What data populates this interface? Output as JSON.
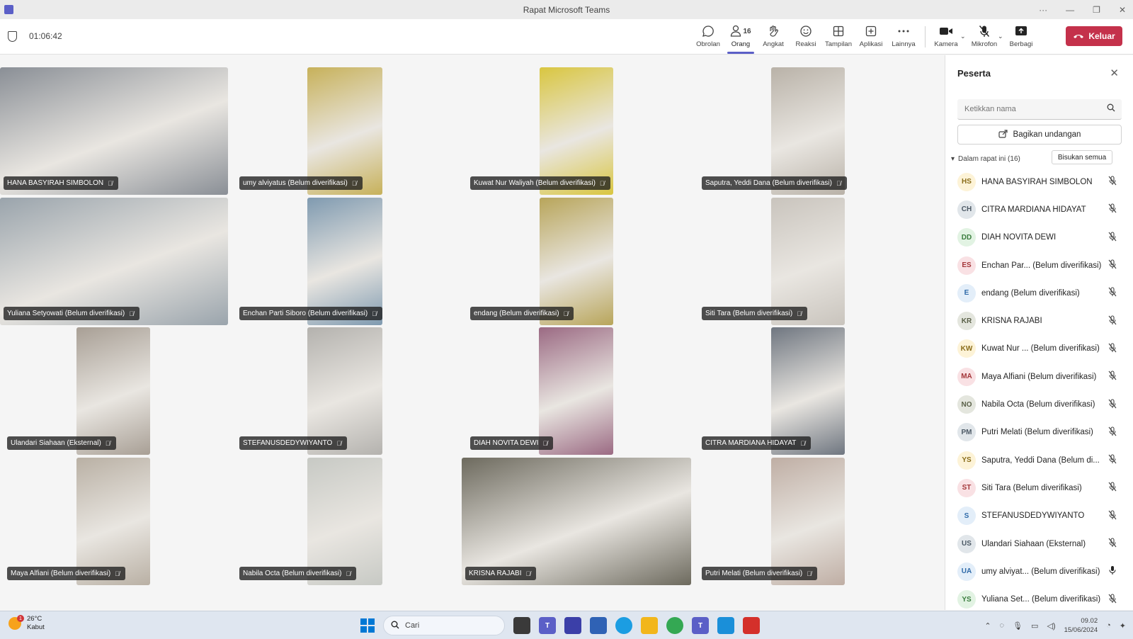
{
  "window": {
    "title": "Rapat Microsoft Teams",
    "controls": [
      "···",
      "—",
      "❐",
      "✕"
    ]
  },
  "toolbar": {
    "timer": "01:06:42",
    "buttons": [
      {
        "label": "Obrolan",
        "icon": "chat-icon"
      },
      {
        "label": "Orang",
        "icon": "people-icon",
        "count": "16",
        "active": true
      },
      {
        "label": "Angkat",
        "icon": "raise-hand-icon"
      },
      {
        "label": "Reaksi",
        "icon": "reaction-icon"
      },
      {
        "label": "Tampilan",
        "icon": "view-icon"
      },
      {
        "label": "Aplikasi",
        "icon": "apps-icon"
      },
      {
        "label": "Lainnya",
        "icon": "more-icon"
      },
      {
        "label": "Kamera",
        "icon": "camera-icon"
      },
      {
        "label": "Mikrofon",
        "icon": "mic-off-icon"
      },
      {
        "label": "Berbagi",
        "icon": "share-icon"
      }
    ],
    "leave_label": "Keluar"
  },
  "tiles": [
    {
      "name": "HANA BASYIRAH SIMBOLON",
      "tone": "#8a8f96"
    },
    {
      "name": "umy alviyatus (Belum diverifikasi)",
      "tone": "#c7b15a"
    },
    {
      "name": "Kuwat Nur Waliyah (Belum diverifikasi)",
      "tone": "#d9c640"
    },
    {
      "name": "Saputra, Yeddi Dana (Belum diverifikasi)",
      "tone": "#b9b2a8"
    },
    {
      "name": "Yuliana Setyowati (Belum diverifikasi)",
      "tone": "#9aa4ac"
    },
    {
      "name": "Enchan Parti Siboro (Belum diverifikasi)",
      "tone": "#7f9ab0"
    },
    {
      "name": "endang (Belum diverifikasi)",
      "tone": "#b8a55a"
    },
    {
      "name": "Siti Tara (Belum diverifikasi)",
      "tone": "#c9c4bd"
    },
    {
      "name": "Ulandari Siahaan (Eksternal)",
      "tone": "#a89f95"
    },
    {
      "name": "STEFANUSDEDYWIYANTO",
      "tone": "#b4b2ae"
    },
    {
      "name": "DIAH NOVITA DEWI",
      "tone": "#9b6a83"
    },
    {
      "name": "CITRA MARDIANA HIDAYAT",
      "tone": "#6f7680"
    },
    {
      "name": "Maya Alfiani (Belum diverifikasi)",
      "tone": "#b9b0a4"
    },
    {
      "name": "Nabila Octa (Belum diverifikasi)",
      "tone": "#c7c9c4"
    },
    {
      "name": "KRISNA RAJABI",
      "tone": "#6d6a5e"
    },
    {
      "name": "Putri Melati (Belum diverifikasi)",
      "tone": "#bfaea4"
    }
  ],
  "panel": {
    "title": "Peserta",
    "search_placeholder": "Ketikkan nama",
    "share_invite": "Bagikan undangan",
    "in_meeting": "Dalam rapat ini (16)",
    "mute_all": "Bisukan semua",
    "participants": [
      {
        "initials": "HS",
        "name": "HANA BASYIRAH SIMBOLON",
        "bg": "#fdf3d7",
        "fg": "#8a6d1a",
        "mic": "muted"
      },
      {
        "initials": "CH",
        "name": "CITRA MARDIANA HIDAYAT",
        "bg": "#e1e6ea",
        "fg": "#4d5a66",
        "mic": "muted"
      },
      {
        "initials": "DD",
        "name": "DIAH NOVITA DEWI",
        "bg": "#e2f3e3",
        "fg": "#3a7d3e",
        "mic": "muted"
      },
      {
        "initials": "ES",
        "name": "Enchan Par... (Belum diverifikasi)",
        "bg": "#f9e1e4",
        "fg": "#a4373a",
        "mic": "muted"
      },
      {
        "initials": "E",
        "name": "endang (Belum diverifikasi)",
        "bg": "#e3eef9",
        "fg": "#2f6aa8",
        "mic": "muted"
      },
      {
        "initials": "KR",
        "name": "KRISNA RAJABI",
        "bg": "#e4e6de",
        "fg": "#5a6048",
        "mic": "muted"
      },
      {
        "initials": "KW",
        "name": "Kuwat Nur ... (Belum diverifikasi)",
        "bg": "#fdf3d7",
        "fg": "#8a6d1a",
        "mic": "muted"
      },
      {
        "initials": "MA",
        "name": "Maya Alfiani (Belum diverifikasi)",
        "bg": "#f9e1e4",
        "fg": "#a4373a",
        "mic": "muted"
      },
      {
        "initials": "NO",
        "name": "Nabila Octa (Belum diverifikasi)",
        "bg": "#e4e6de",
        "fg": "#5a6048",
        "mic": "muted"
      },
      {
        "initials": "PM",
        "name": "Putri Melati (Belum diverifikasi)",
        "bg": "#e1e6ea",
        "fg": "#4d5a66",
        "mic": "muted"
      },
      {
        "initials": "YS",
        "name": "Saputra, Yeddi Dana (Belum di...",
        "bg": "#fdf3d7",
        "fg": "#8a6d1a",
        "mic": "muted"
      },
      {
        "initials": "ST",
        "name": "Siti Tara (Belum diverifikasi)",
        "bg": "#f9e1e4",
        "fg": "#a4373a",
        "mic": "muted"
      },
      {
        "initials": "S",
        "name": "STEFANUSDEDYWIYANTO",
        "bg": "#e3eef9",
        "fg": "#2f6aa8",
        "mic": "muted"
      },
      {
        "initials": "US",
        "name": "Ulandari Siahaan (Eksternal)",
        "bg": "#e1e6ea",
        "fg": "#4d5a66",
        "mic": "muted"
      },
      {
        "initials": "UA",
        "name": "umy alviyat... (Belum diverifikasi)",
        "bg": "#e3eef9",
        "fg": "#2f6aa8",
        "mic": "on"
      },
      {
        "initials": "YS",
        "name": "Yuliana Set... (Belum diverifikasi)",
        "bg": "#e2f3e3",
        "fg": "#3a7d3e",
        "mic": "muted"
      }
    ]
  },
  "taskbar": {
    "weather_temp": "26°C",
    "weather_desc": "Kabut",
    "weather_badge": "1",
    "search_label": "Cari",
    "time": "09.02",
    "date": "15/06/2024"
  }
}
